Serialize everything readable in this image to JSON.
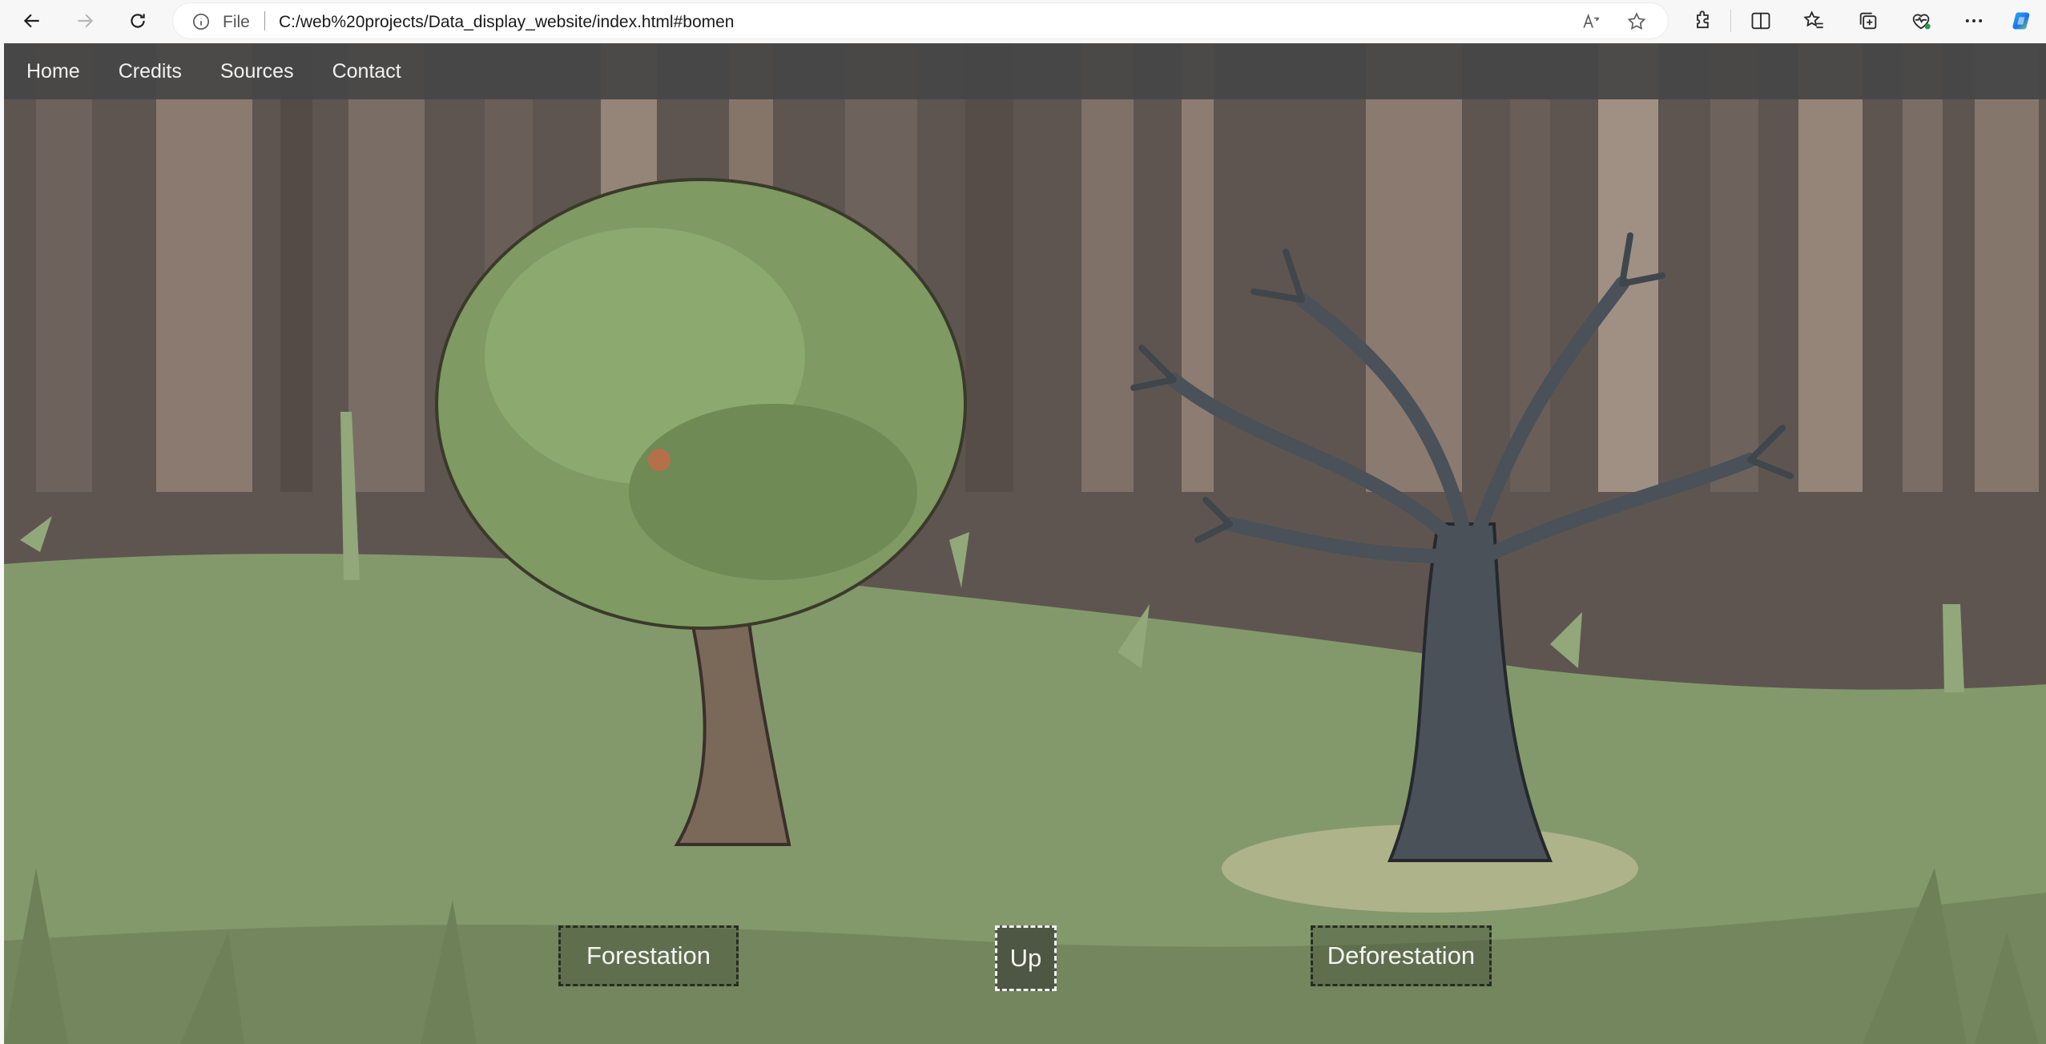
{
  "browser": {
    "nav": {
      "back_icon": "arrow-left-icon",
      "forward_icon": "arrow-right-icon",
      "refresh_icon": "refresh-icon"
    },
    "address": {
      "scheme_label": "File",
      "url": "C:/web%20projects/Data_display_website/index.html#bomen"
    },
    "toolbar_icons": [
      "read-aloud-icon",
      "favorite-star-icon",
      "extensions-icon",
      "split-screen-icon",
      "favorites-icon",
      "collections-icon",
      "browser-essentials-icon",
      "more-options-icon",
      "copilot-icon"
    ]
  },
  "site": {
    "nav": {
      "home": "Home",
      "credits": "Credits",
      "sources": "Sources",
      "contact": "Contact"
    },
    "buttons": {
      "forestation": "Forestation",
      "up": "Up",
      "deforestation": "Deforestation"
    }
  },
  "colors": {
    "background_trunks": "#5e5551",
    "grass": "#84996b",
    "grass_dark": "#74865e",
    "tree_foliage": "#7f9a62",
    "dead_tree": "#4a5158",
    "nav_bar": "#464646"
  }
}
